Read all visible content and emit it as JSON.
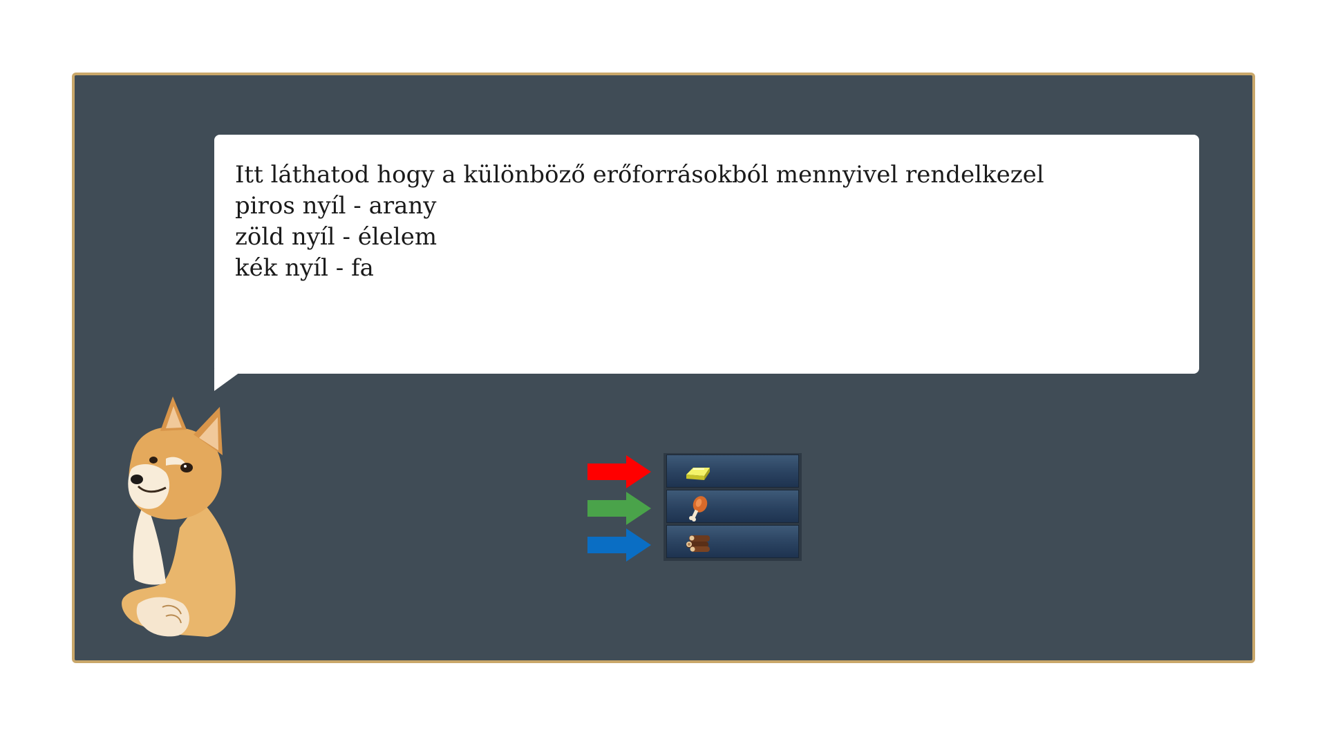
{
  "dialog": {
    "lines": [
      "Itt láthatod hogy a különböző erőforrásokból mennyivel rendelkezel",
      "piros nyíl - arany",
      "zöld nyíl - élelem",
      "kék nyíl - fa"
    ]
  },
  "character": {
    "icon": "shiba-dog-icon"
  },
  "resources": [
    {
      "name": "arany",
      "icon": "gold-bar-icon",
      "arrow_color": "#ff0000",
      "value": ""
    },
    {
      "name": "élelem",
      "icon": "meat-drumstick-icon",
      "arrow_color": "#4aa34a",
      "value": ""
    },
    {
      "name": "fa",
      "icon": "wood-logs-icon",
      "arrow_color": "#0a6ec4",
      "value": ""
    }
  ],
  "colors": {
    "panel_background": "#404c56",
    "panel_border": "#c9a76a",
    "bubble_background": "#ffffff"
  }
}
